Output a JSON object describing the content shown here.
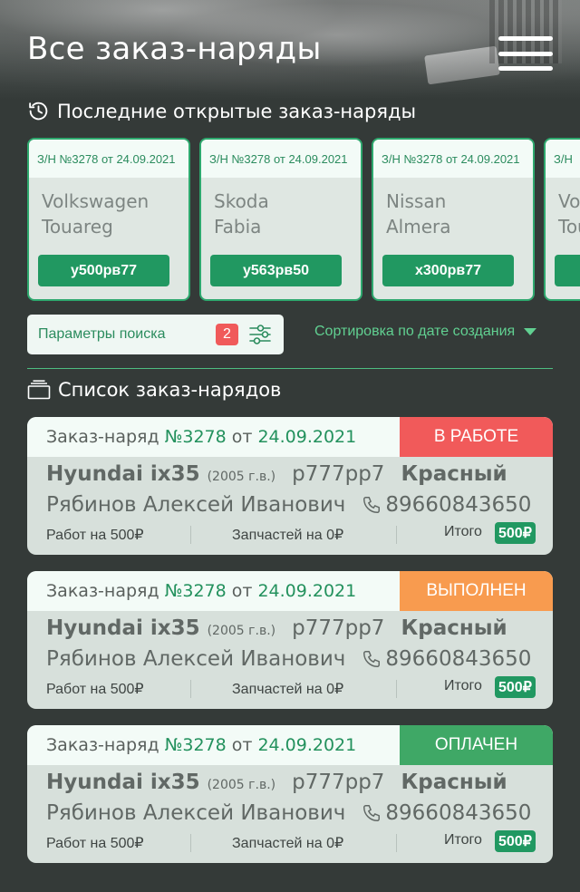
{
  "header": {
    "title": "Все заказ-наряды",
    "menu_icon": "hamburger-menu-icon"
  },
  "recent": {
    "heading": "Последние открытые заказ-наряды",
    "icon": "history-clock-icon",
    "cards": [
      {
        "label": "З/Н №3278 от 24.09.2021",
        "make": "Volkswagen",
        "model": "Touareg",
        "plate": "у500рв77"
      },
      {
        "label": "З/Н №3278 от 24.09.2021",
        "make": "Skoda",
        "model": "Fabia",
        "plate": "у563рв50"
      },
      {
        "label": "З/Н №3278 от 24.09.2021",
        "make": "Nissan",
        "model": "Almera",
        "plate": "х300рв77"
      },
      {
        "label": "З/Н",
        "make": "Vol",
        "model": "Tou",
        "plate": ""
      }
    ]
  },
  "search": {
    "label": "Параметры поиска",
    "badge": "2",
    "icon": "sliders-filter-icon"
  },
  "sort": {
    "label": "Сортировка по дате создания",
    "icon": "triangle-down-icon"
  },
  "list": {
    "heading": "Список заказ-нарядов",
    "icon": "folder-stack-icon",
    "orders": [
      {
        "prefix": "Заказ-наряд",
        "number": "№3278",
        "from": "от",
        "date": "24.09.2021",
        "status": "В РАБОТЕ",
        "status_color": "#f15a5a",
        "model": "Hyundai ix35",
        "year": "(2005 г.в.)",
        "plate": "р777рр7",
        "color": "Красный",
        "owner": "Рябинов Алексей Иванович",
        "phone": "89660843650",
        "works": "Работ на 500₽",
        "parts": "Запчастей на 0₽",
        "total_label": "Итого",
        "total": "500₽"
      },
      {
        "prefix": "Заказ-наряд",
        "number": "№3278",
        "from": "от",
        "date": "24.09.2021",
        "status": "ВЫПОЛНЕН",
        "status_color": "#f89b4f",
        "model": "Hyundai ix35",
        "year": "(2005 г.в.)",
        "plate": "р777рр7",
        "color": "Красный",
        "owner": "Рябинов Алексей Иванович",
        "phone": "89660843650",
        "works": "Работ на 500₽",
        "parts": "Запчастей на 0₽",
        "total_label": "Итого",
        "total": "500₽"
      },
      {
        "prefix": "Заказ-наряд",
        "number": "№3278",
        "from": "от",
        "date": "24.09.2021",
        "status": "ОПЛАЧЕН",
        "status_color": "#3fa866",
        "model": "Hyundai ix35",
        "year": "(2005 г.в.)",
        "plate": "р777рр7",
        "color": "Красный",
        "owner": "Рябинов Алексей Иванович",
        "phone": "89660843650",
        "works": "Работ на 500₽",
        "parts": "Запчастей на 0₽",
        "total_label": "Итого",
        "total": "500₽"
      }
    ]
  }
}
